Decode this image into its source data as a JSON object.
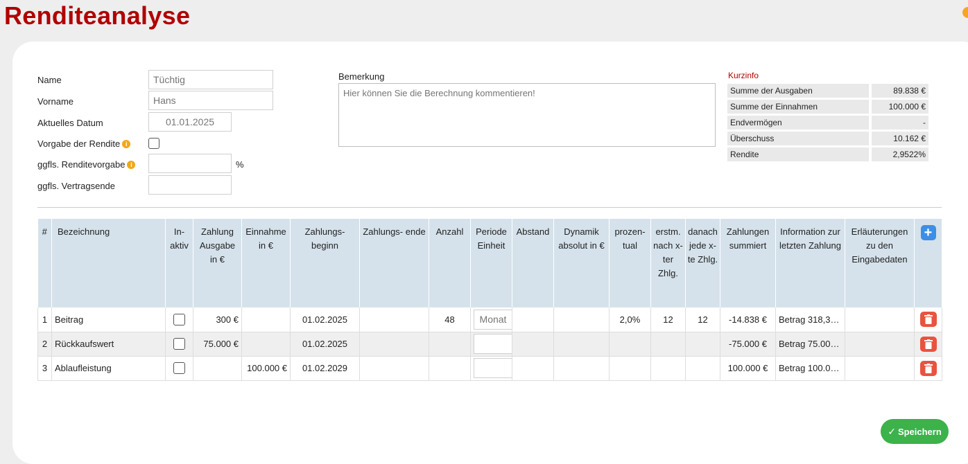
{
  "page": {
    "title": "Renditeanalyse"
  },
  "form": {
    "name_label": "Name",
    "name_placeholder": "Tüchtig",
    "vorname_label": "Vorname",
    "vorname_placeholder": "Hans",
    "datum_label": "Aktuelles Datum",
    "datum_value": "01.01.2025",
    "vorgabe_label": "Vorgabe der Rendite",
    "renditevorgabe_label": "ggfls. Renditevorgabe",
    "percent_unit": "%",
    "vertragsende_label": "ggfls. Vertragsende",
    "bemerkung_label": "Bemerkung",
    "bemerkung_placeholder": "Hier können Sie die Berechnung kommentieren!"
  },
  "kurzinfo": {
    "title": "Kurzinfo",
    "rows": [
      {
        "label": "Summe der Ausgaben",
        "value": "89.838 €"
      },
      {
        "label": "Summe der Einnahmen",
        "value": "100.000 €"
      },
      {
        "label": "Endvermögen",
        "value": "-"
      },
      {
        "label": "Überschuss",
        "value": "10.162 €"
      },
      {
        "label": "Rendite",
        "value": "2,9522%"
      }
    ]
  },
  "table": {
    "headers": {
      "num": "#",
      "bezeichnung": "Bezeichnung",
      "inaktiv": "In- aktiv",
      "ausgabe": "Zahlung Ausgabe in €",
      "einnahme": "Einnahme in €",
      "beginn": "Zahlungs- beginn",
      "ende": "Zahlungs- ende",
      "anzahl": "Anzahl",
      "periode": "Periode Einheit",
      "abstand": "Abstand",
      "dynamik": "Dynamik absolut in €",
      "prozentual": "prozen- tual",
      "erstm": "erstm. nach x- ter Zhlg.",
      "danach": "danach jede x- te Zhlg.",
      "summiert": "Zahlungen summiert",
      "info": "Information zur letzten Zahlung",
      "erlaeuterungen": "Erläuterungen zu den Eingabedaten"
    },
    "period_placeholder": "Monat",
    "rows": [
      {
        "num": "1",
        "bezeichnung": "Beitrag",
        "ausgabe": "300 €",
        "einnahme": "",
        "beginn": "01.02.2025",
        "ende": "",
        "anzahl": "48",
        "abstand": "",
        "dynamik": "",
        "prozentual": "2,0%",
        "erstm": "12",
        "danach": "12",
        "summiert": "-14.838 €",
        "info": "Betrag 318,3…",
        "erlaeuterungen": ""
      },
      {
        "num": "2",
        "bezeichnung": "Rückkaufswert",
        "ausgabe": "75.000 €",
        "einnahme": "",
        "beginn": "01.02.2025",
        "ende": "",
        "anzahl": "",
        "abstand": "",
        "dynamik": "",
        "prozentual": "",
        "erstm": "",
        "danach": "",
        "summiert": "-75.000 €",
        "info": "Betrag 75.00…",
        "erlaeuterungen": ""
      },
      {
        "num": "3",
        "bezeichnung": "Ablaufleistung",
        "ausgabe": "",
        "einnahme": "100.000 €",
        "beginn": "01.02.2029",
        "ende": "",
        "anzahl": "",
        "abstand": "",
        "dynamik": "",
        "prozentual": "",
        "erstm": "",
        "danach": "",
        "summiert": "100.000 €",
        "info": "Betrag 100.0…",
        "erlaeuterungen": ""
      }
    ]
  },
  "actions": {
    "save_label": "Speichern",
    "add_icon": "plus-icon",
    "delete_icon": "trash-icon"
  },
  "colors": {
    "title": "#b10000",
    "header_bg": "#d5e2eb",
    "save": "#3cb24a",
    "delete": "#e9533f",
    "add": "#3d8ee6"
  }
}
